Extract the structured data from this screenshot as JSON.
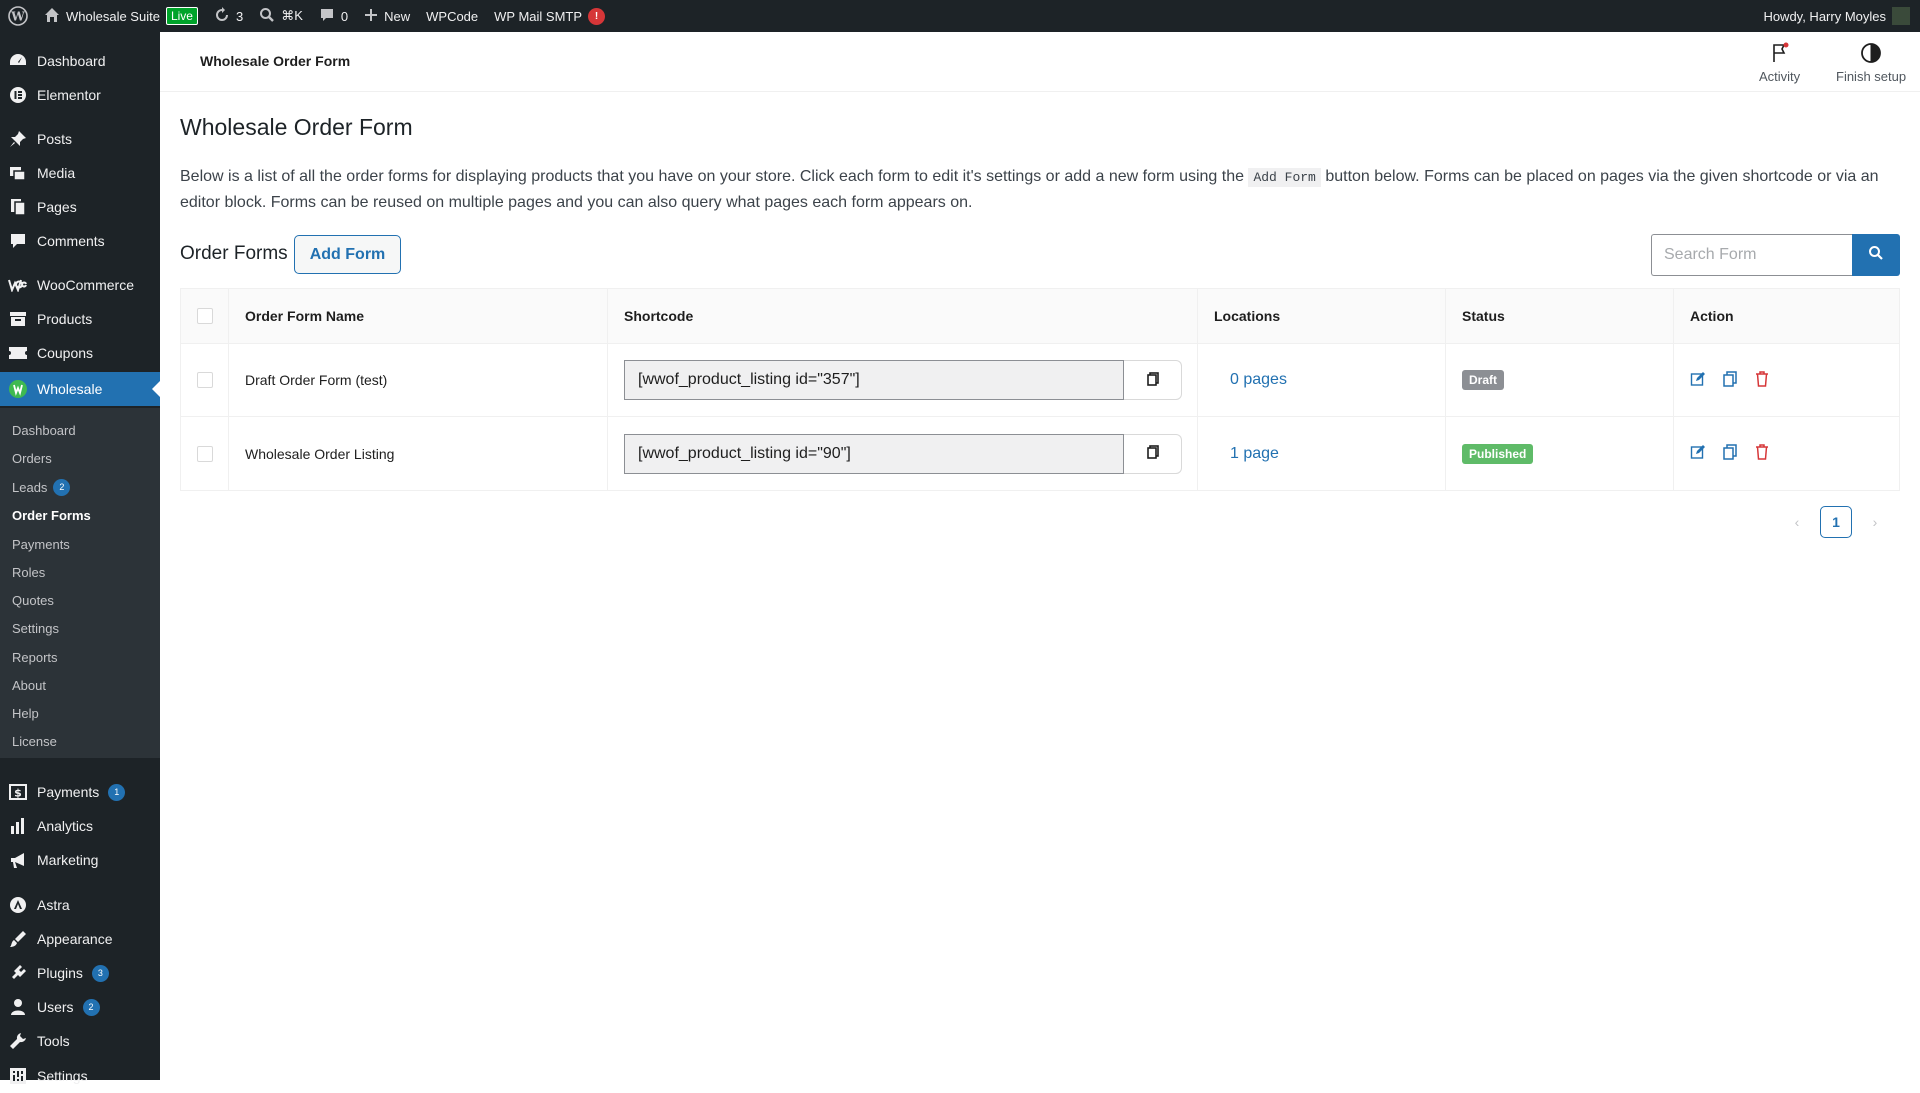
{
  "adminbar": {
    "site_name": "Wholesale Suite",
    "live_label": "Live",
    "updates_count": "3",
    "search_shortcut": "⌘K",
    "comments_count": "0",
    "new_label": "New",
    "wpcode_label": "WPCode",
    "smtp_label": "WP Mail SMTP",
    "smtp_alert": "!",
    "greeting": "Howdy, Harry Moyles"
  },
  "sidebar": {
    "items": [
      {
        "label": "Dashboard",
        "icon": "dashboard-icon"
      },
      {
        "label": "Elementor",
        "icon": "elementor-icon"
      },
      {
        "label": "Posts",
        "icon": "pin-icon"
      },
      {
        "label": "Media",
        "icon": "media-icon"
      },
      {
        "label": "Pages",
        "icon": "pages-icon"
      },
      {
        "label": "Comments",
        "icon": "comment-icon"
      },
      {
        "label": "WooCommerce",
        "icon": "woo-icon"
      },
      {
        "label": "Products",
        "icon": "archive-icon"
      },
      {
        "label": "Coupons",
        "icon": "coupon-icon"
      },
      {
        "label": "Wholesale",
        "icon": "wholesale-icon"
      },
      {
        "label": "Payments",
        "icon": "dollar-icon",
        "badge": "1"
      },
      {
        "label": "Analytics",
        "icon": "chart-icon"
      },
      {
        "label": "Marketing",
        "icon": "megaphone-icon"
      },
      {
        "label": "Astra",
        "icon": "astra-icon"
      },
      {
        "label": "Appearance",
        "icon": "brush-icon"
      },
      {
        "label": "Plugins",
        "icon": "plugin-icon",
        "badge": "3"
      },
      {
        "label": "Users",
        "icon": "user-icon",
        "badge": "2"
      },
      {
        "label": "Tools",
        "icon": "wrench-icon"
      },
      {
        "label": "Settings",
        "icon": "settings-icon"
      }
    ],
    "submenu": [
      {
        "label": "Dashboard"
      },
      {
        "label": "Orders"
      },
      {
        "label": "Leads",
        "badge": "2"
      },
      {
        "label": "Order Forms"
      },
      {
        "label": "Payments"
      },
      {
        "label": "Roles"
      },
      {
        "label": "Quotes"
      },
      {
        "label": "Settings"
      },
      {
        "label": "Reports"
      },
      {
        "label": "About"
      },
      {
        "label": "Help"
      },
      {
        "label": "License"
      }
    ]
  },
  "topbar": {
    "title": "Wholesale Order Form",
    "activity_label": "Activity",
    "finish_setup_label": "Finish setup"
  },
  "main": {
    "title": "Wholesale Order Form",
    "description_before": "Below is a list of all the order forms for displaying products that you have on your store. Click each form to edit it's settings or add a new form using the ",
    "description_code": "Add Form",
    "description_after": " button below. Forms can be placed on pages via the given shortcode or via an editor block. Forms can be reused on multiple pages and you can also query what pages each form appears on.",
    "section_title": "Order Forms",
    "add_form_label": "Add Form",
    "search_placeholder": "Search Form"
  },
  "table": {
    "headers": {
      "name": "Order Form Name",
      "shortcode": "Shortcode",
      "locations": "Locations",
      "status": "Status",
      "action": "Action"
    },
    "rows": [
      {
        "name": "Draft Order Form (test)",
        "shortcode": "[wwof_product_listing id=\"357\"]",
        "locations": "0 pages",
        "status": "Draft"
      },
      {
        "name": "Wholesale Order Listing",
        "shortcode": "[wwof_product_listing id=\"90\"]",
        "locations": "1 page",
        "status": "Published"
      }
    ]
  },
  "pagination": {
    "current_page": "1"
  },
  "colors": {
    "admin_dark": "#1d2327",
    "accent": "#2271b1",
    "delete_red": "#d63638",
    "published_green": "#5fbb68",
    "draft_grey": "#8c8f94"
  }
}
